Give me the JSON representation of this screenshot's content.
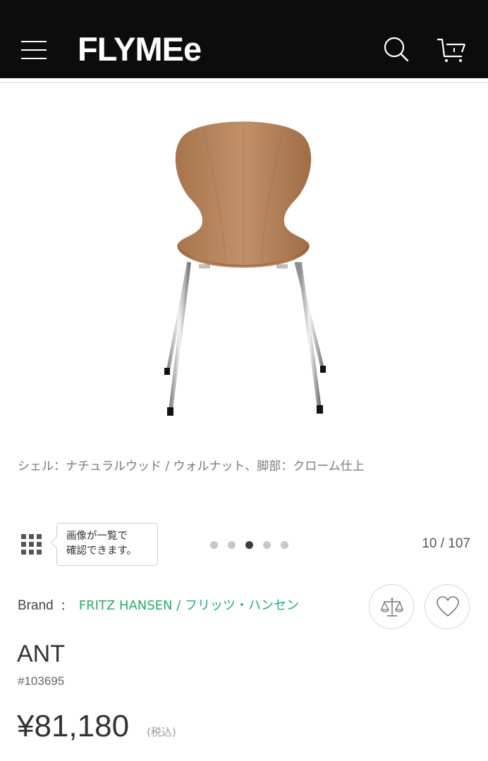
{
  "header": {
    "logo": "FLYMEe",
    "menu_icon": "hamburger-menu-icon",
    "search_icon": "search-icon",
    "cart_icon": "cart-icon",
    "background": "#0c0c0c"
  },
  "gallery": {
    "image_subject": "ANT chair with walnut shell and chrome legs",
    "caption": "シェル：ナチュラルウッド / ウォルナット、脚部：クローム仕上",
    "grid_icon": "grid-icon",
    "tooltip": {
      "line1": "画像が一覧で",
      "line2": "確認できます。"
    },
    "dots_count": 5,
    "active_dot": 3,
    "counter": "10 / 107"
  },
  "product": {
    "brand_label": "Brand",
    "brand_separator": "：",
    "brand_name": "FRITZ HANSEN / フリッツ・ハンセン",
    "brand_color": "#2aaa6f",
    "compare_icon": "scale-icon",
    "favorite_icon": "heart-icon",
    "name": "ANT",
    "id": "#103695",
    "price": "¥81,180",
    "tax_note": "(税込)"
  }
}
